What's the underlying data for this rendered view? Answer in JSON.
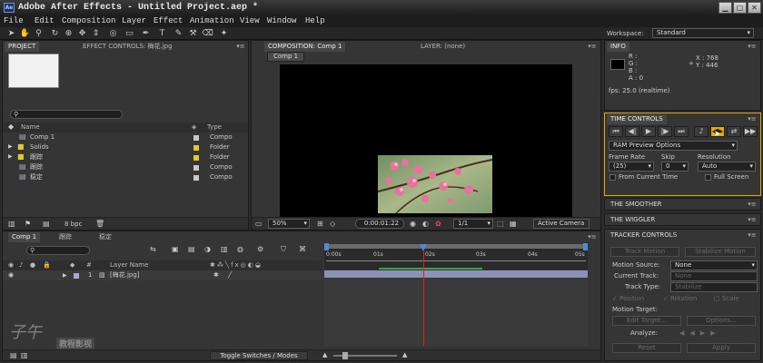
{
  "window": {
    "title": "Adobe After Effects - Untitled Project.aep *",
    "app_icon": "Ae"
  },
  "menu": [
    "File",
    "Edit",
    "Composition",
    "Layer",
    "Effect",
    "Animation",
    "View",
    "Window",
    "Help"
  ],
  "workspace": {
    "label": "Workspace:",
    "value": "Standard"
  },
  "project": {
    "tab_project": "PROJECT",
    "tab_effect_controls": "EFFECT CONTROLS: 梅花.jpg",
    "col_name": "Name",
    "col_type": "Type",
    "items": [
      {
        "name": "Comp 1",
        "type": "Compo"
      },
      {
        "name": "Solids",
        "type": "Folder"
      },
      {
        "name": "跟踪",
        "type": "Folder"
      },
      {
        "name": "跟踪",
        "type": "Compo"
      },
      {
        "name": "稳定",
        "type": "Compo"
      }
    ],
    "bpc": "8 bpc"
  },
  "composition": {
    "tab": "COMPOSITION: Comp 1",
    "layer_tab": "LAYER: (none)",
    "comp_button": "Comp 1",
    "zoom": "50%",
    "timecode": "0:00:01:22",
    "resolution": "1/1",
    "camera": "Active Camera"
  },
  "info": {
    "tab": "INFO",
    "r": "R :",
    "g": "G :",
    "b": "B :",
    "a": "A : 0",
    "x": "X : 768",
    "y": "Y : 446",
    "fps": "fps: 25.0 (realtime)"
  },
  "time_controls": {
    "tab": "TIME CONTROLS",
    "ram_preview": "RAM Preview Options",
    "frame_rate_label": "Frame Rate",
    "skip_label": "Skip",
    "resolution_label": "Resolution",
    "frame_rate_value": "(25)",
    "skip_value": "0",
    "resolution_value": "Auto",
    "from_current_time": "From Current Time",
    "full_screen": "Full Screen"
  },
  "smoother": {
    "tab": "THE SMOOTHER"
  },
  "wiggler": {
    "tab": "THE WIGGLER"
  },
  "tracker": {
    "tab": "TRACKER CONTROLS",
    "track_motion": "Track Motion",
    "stabilize_motion": "Stabilize Motion",
    "motion_source_label": "Motion Source:",
    "motion_source_value": "None",
    "current_track_label": "Current Track:",
    "current_track_value": "None",
    "track_type_label": "Track Type:",
    "track_type_value": "Stabilize",
    "position": "Position",
    "rotation": "Rotation",
    "scale": "Scale",
    "motion_target_label": "Motion Target:",
    "edit_target": "Edit Target...",
    "options": "Options...",
    "analyze_label": "Analyze:",
    "reset": "Reset",
    "apply": "Apply"
  },
  "timeline": {
    "tabs": [
      "Comp 1",
      "跟踪",
      "稳定"
    ],
    "col_num": "#",
    "col_layer_name": "Layer Name",
    "layer_num": "1",
    "layer_name": "[梅花.jpg]",
    "ruler": [
      "0:00s",
      "01s",
      "02s",
      "03s",
      "04s",
      "05s"
    ],
    "toggle": "Toggle Switches / Modes"
  },
  "watermark": {
    "line1": "子午",
    "line2": "教程影视"
  },
  "colors": {
    "accent": "#e8a800",
    "playhead": "#e02020",
    "workarea": "#3aa04a",
    "layerbar": "#8e91b6"
  }
}
